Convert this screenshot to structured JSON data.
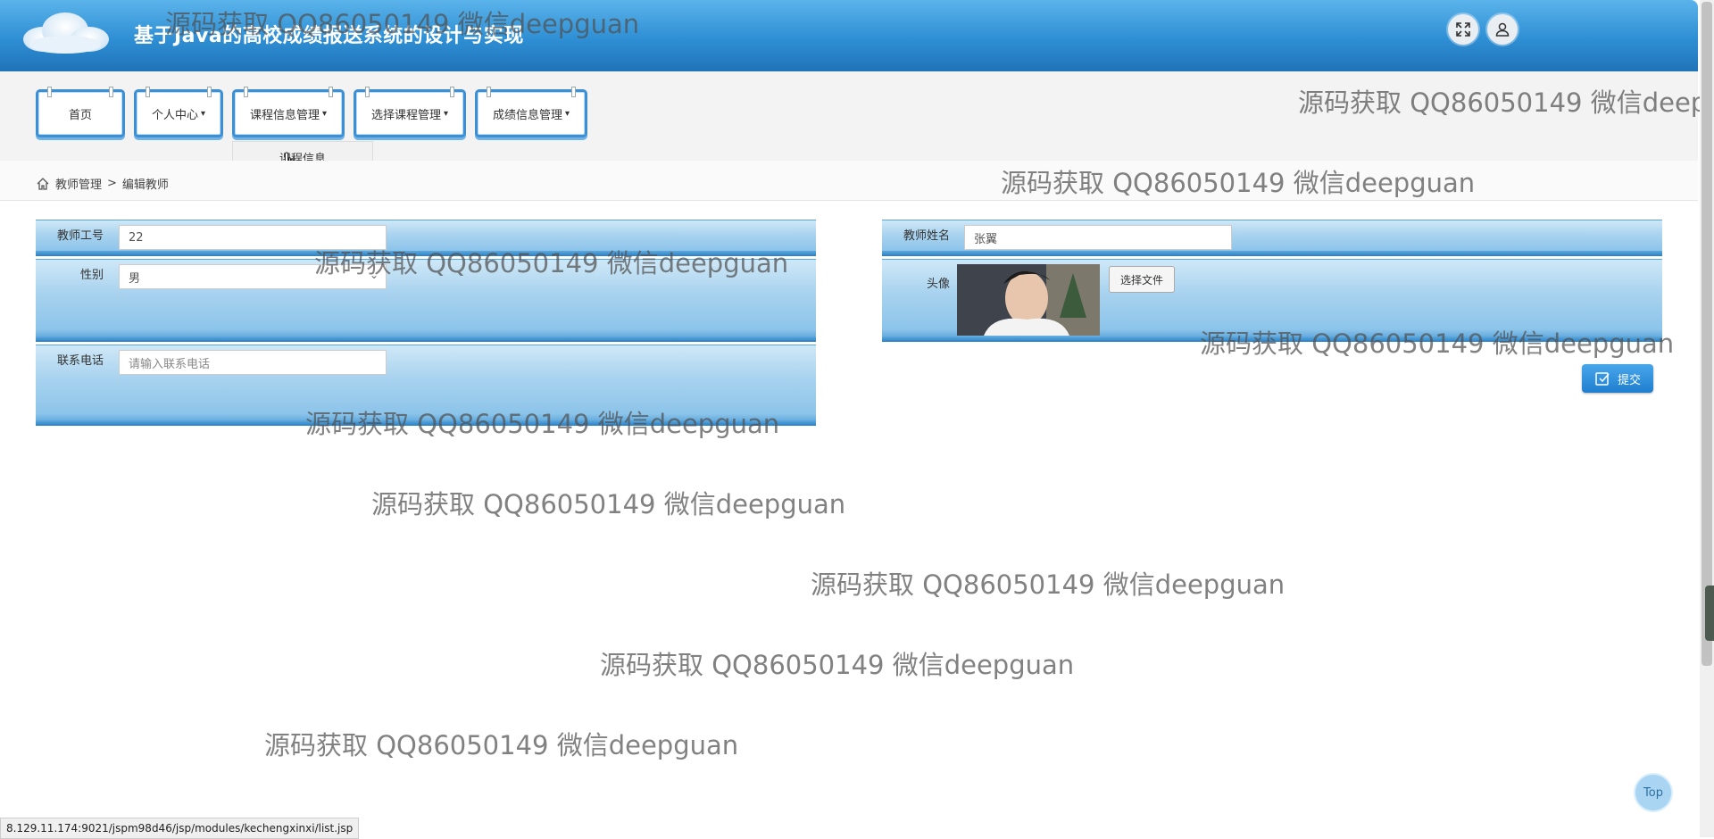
{
  "header": {
    "title": "基于Java的高校成绩报送系统的设计与实现",
    "fullscreen_icon": "expand-icon",
    "user_icon": "user-icon"
  },
  "nav": {
    "items": [
      {
        "label": "首页",
        "has_dropdown": false
      },
      {
        "label": "个人中心",
        "has_dropdown": true
      },
      {
        "label": "课程信息管理",
        "has_dropdown": true
      },
      {
        "label": "选择课程管理",
        "has_dropdown": true
      },
      {
        "label": "成绩信息管理",
        "has_dropdown": true
      }
    ],
    "caret": "▾",
    "open_dropdown": {
      "items": [
        "课程信息"
      ]
    }
  },
  "breadcrumb": {
    "home_icon": "home-icon",
    "section": "教师管理",
    "separator": ">",
    "page": "编辑教师"
  },
  "form": {
    "teacher_id": {
      "label": "教师工号",
      "value": "22"
    },
    "teacher_name": {
      "label": "教师姓名",
      "value": "张翼"
    },
    "gender": {
      "label": "性别",
      "value": "男"
    },
    "avatar": {
      "label": "头像",
      "file_button": "选择文件"
    },
    "phone": {
      "label": "联系电话",
      "placeholder": "请输入联系电话"
    },
    "submit_label": "提交"
  },
  "watermark_text": "源码获取 QQ86050149 微信deepguan",
  "top_button": "Top",
  "status_bar_url": "8.129.11.174:9021/jspm98d46/jsp/modules/kechengxinxi/list.jsp",
  "colors": {
    "header_blue": "#2f8fd4",
    "panel_blue": "#8cc4ea",
    "nav_border": "#3c8fd2"
  }
}
